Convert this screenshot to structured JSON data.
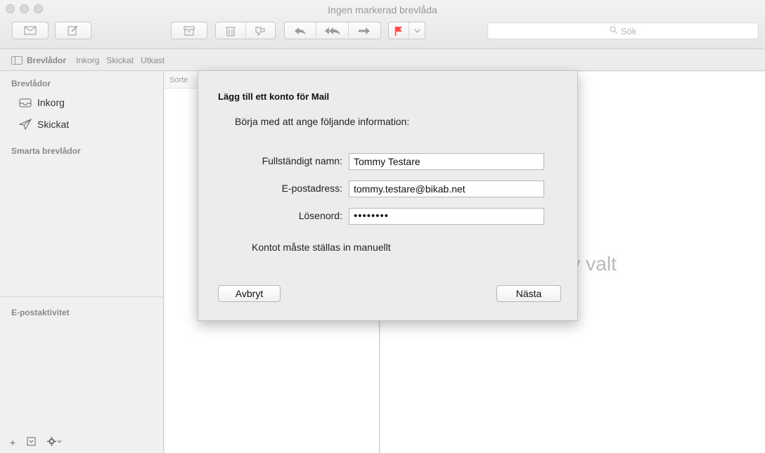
{
  "window": {
    "title": "Ingen markerad brevlåda"
  },
  "toolbar": {
    "buttons": [
      "envelope-icon",
      "compose-icon",
      "archive-icon",
      "trash-icon",
      "junk-icon",
      "reply-icon",
      "reply-all-icon",
      "forward-icon",
      "flag-icon",
      "chevron-down-icon"
    ],
    "search_placeholder": "Sök"
  },
  "favorites": {
    "mailboxes_label": "Brevlådor",
    "items": [
      "Inkorg",
      "Skickat",
      "Utkast"
    ]
  },
  "sidebar": {
    "section_mailboxes": "Brevlådor",
    "items": [
      {
        "label": "Inkorg",
        "icon": "inbox-icon"
      },
      {
        "label": "Skickat",
        "icon": "paper-plane-icon"
      }
    ],
    "section_smart": "Smarta brevlådor",
    "section_activity": "E-postaktivitet",
    "bottom_icons": [
      "plus-icon",
      "mailbox-toggle-icon",
      "gear-icon"
    ]
  },
  "message_list": {
    "sort_label": "Sorte"
  },
  "viewer": {
    "empty_text": "Inget brev valt"
  },
  "dialog": {
    "title": "Lägg till ett konto för Mail",
    "intro": "Börja med att ange följande information:",
    "fields": [
      {
        "label": "Fullständigt namn:",
        "value": "Tommy Testare"
      },
      {
        "label": "E-postadress:",
        "value": "tommy.testare@bikab.net"
      },
      {
        "label": "Lösenord:",
        "value": "••••••••"
      }
    ],
    "note": "Kontot måste ställas in manuellt",
    "cancel_label": "Avbryt",
    "next_label": "Nästa"
  },
  "colors": {
    "flag": "#ff4b4b",
    "chrome": "#ececec"
  }
}
